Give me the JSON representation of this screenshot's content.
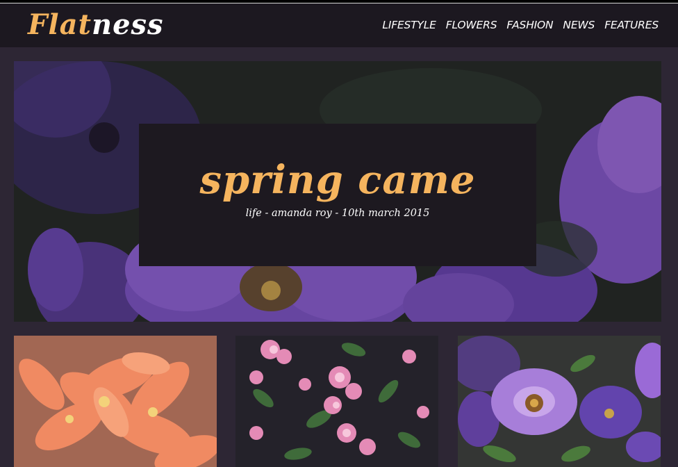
{
  "site": {
    "logo_part1": "Flat",
    "logo_part2": "ness"
  },
  "nav": {
    "items": [
      "LIFESTYLE",
      "FLOWERS",
      "FASHION",
      "NEWS",
      "FEATURES"
    ]
  },
  "hero": {
    "title": "spring came",
    "meta": "life - amanda roy - 10th march 2015",
    "image": "purple-petunias-photo"
  },
  "thumbnails": [
    {
      "image": "orange-lily-flowers-photo"
    },
    {
      "image": "pink-blossom-branches-photo"
    },
    {
      "image": "purple-petunias-closeup-photo"
    }
  ],
  "colors": {
    "accent": "#f5b45e",
    "header_bg": "#1c1820",
    "page_bg": "#2d2634"
  }
}
